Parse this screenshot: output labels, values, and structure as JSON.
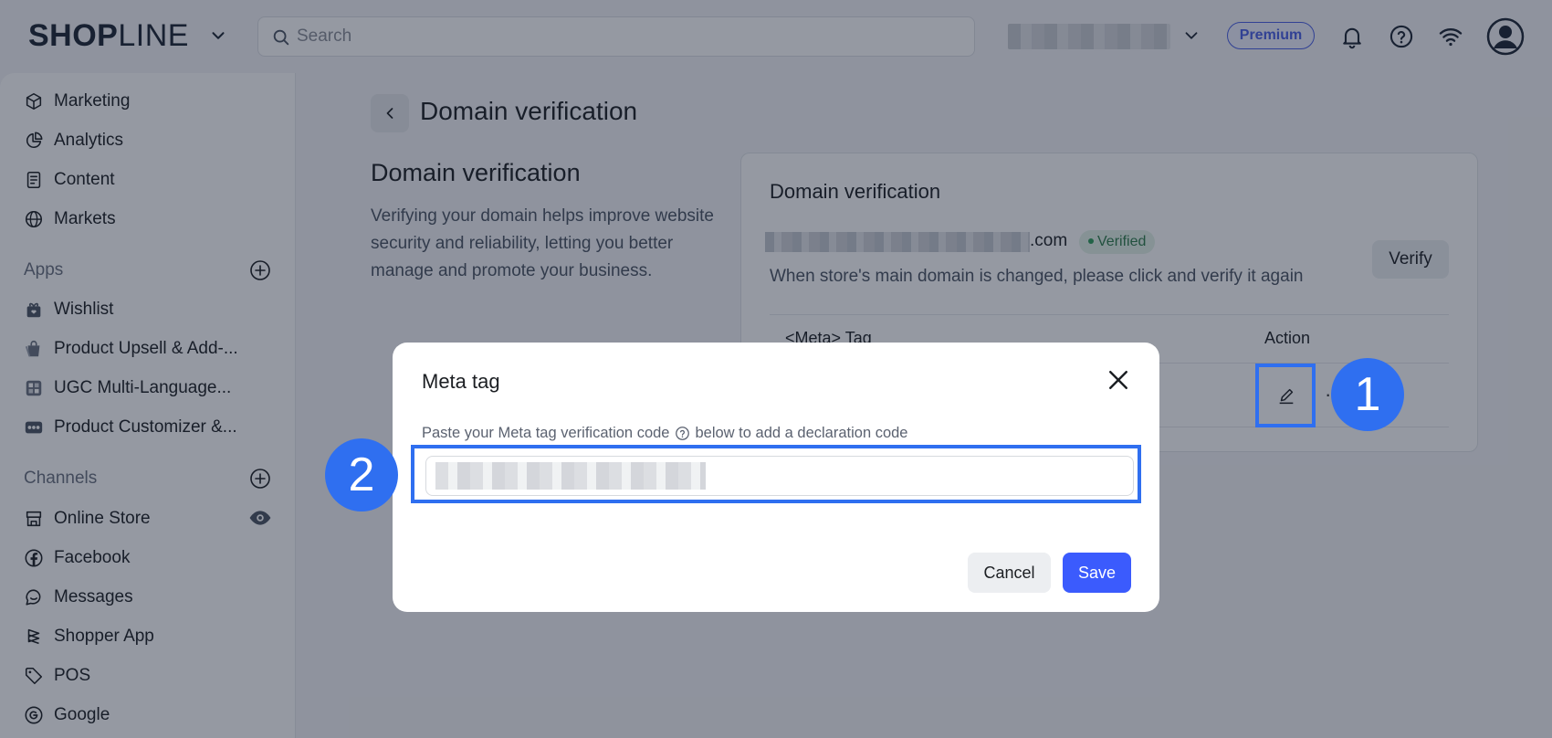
{
  "topbar": {
    "logo_bold": "SHOP",
    "logo_thin": "LINE",
    "search_placeholder": "Search",
    "premium_label": "Premium"
  },
  "sidebar": {
    "items_top": [
      {
        "label": "Marketing",
        "icon": "cube-icon"
      },
      {
        "label": "Analytics",
        "icon": "pie-chart-icon"
      },
      {
        "label": "Content",
        "icon": "document-icon"
      },
      {
        "label": "Markets",
        "icon": "globe-icon"
      }
    ],
    "apps_label": "Apps",
    "apps": [
      {
        "label": "Wishlist",
        "icon": "gift-icon"
      },
      {
        "label": "Product Upsell & Add-...",
        "icon": "bag-icon"
      },
      {
        "label": "UGC Multi-Language...",
        "icon": "grid-app-icon"
      },
      {
        "label": "Product Customizer &...",
        "icon": "customizer-icon"
      }
    ],
    "channels_label": "Channels",
    "channels": [
      {
        "label": "Online Store",
        "icon": "store-icon"
      },
      {
        "label": "Facebook",
        "icon": "facebook-icon"
      },
      {
        "label": "Messages",
        "icon": "chat-icon"
      },
      {
        "label": "Shopper App",
        "icon": "layers-icon"
      },
      {
        "label": "POS",
        "icon": "tag-icon"
      },
      {
        "label": "Google",
        "icon": "google-icon"
      }
    ]
  },
  "main": {
    "page_title": "Domain verification",
    "section_title": "Domain verification",
    "section_desc": "Verifying your domain helps improve website security and reliability, letting you better manage and promote your business.",
    "card": {
      "title": "Domain verification",
      "domain_suffix": ".com",
      "status": "Verified",
      "note": "When store's main domain is changed, please click and verify it again",
      "verify_label": "Verify",
      "col_meta": "<Meta> Tag",
      "col_action": "Action"
    }
  },
  "modal": {
    "title": "Meta tag",
    "label_before": "Paste your Meta tag verification code",
    "label_after": "below to add a declaration code",
    "cancel_label": "Cancel",
    "save_label": "Save"
  },
  "steps": {
    "one": "1",
    "two": "2"
  },
  "colors": {
    "accent": "#3b5bfd",
    "highlight": "#2f6ff0",
    "verified_bg": "#e3f3e8",
    "verified_text": "#2f7d4b"
  }
}
